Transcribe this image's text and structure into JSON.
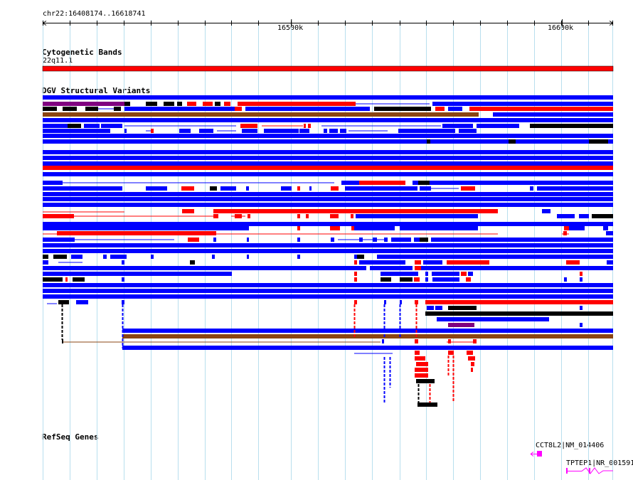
{
  "view": {
    "region": "chr22:16408174..16618741",
    "ticks": [
      {
        "label": "16500k",
        "pos": 16500000
      },
      {
        "label": "16600k",
        "pos": 16600000
      }
    ],
    "range": [
      16408174,
      16618741
    ]
  },
  "tracks": {
    "cytoband": {
      "title": "Cytogenetic Bands",
      "band_name": "22q11.1",
      "color": "#ff0000"
    },
    "dgv": {
      "title": "DGV Structural Variants",
      "colors": {
        "gain": "#ff0000",
        "loss": "#0000ff",
        "both": "#000000",
        "inversion": "#800080",
        "complex": "#8b4513"
      }
    },
    "refseq": {
      "title": "RefSeq Genes",
      "genes": [
        {
          "label": "CCT8L2|NM_014406",
          "color": "#ff00ff"
        },
        {
          "label": "TPTEP1|NR_001591",
          "color": "#ff00ff"
        }
      ]
    }
  }
}
